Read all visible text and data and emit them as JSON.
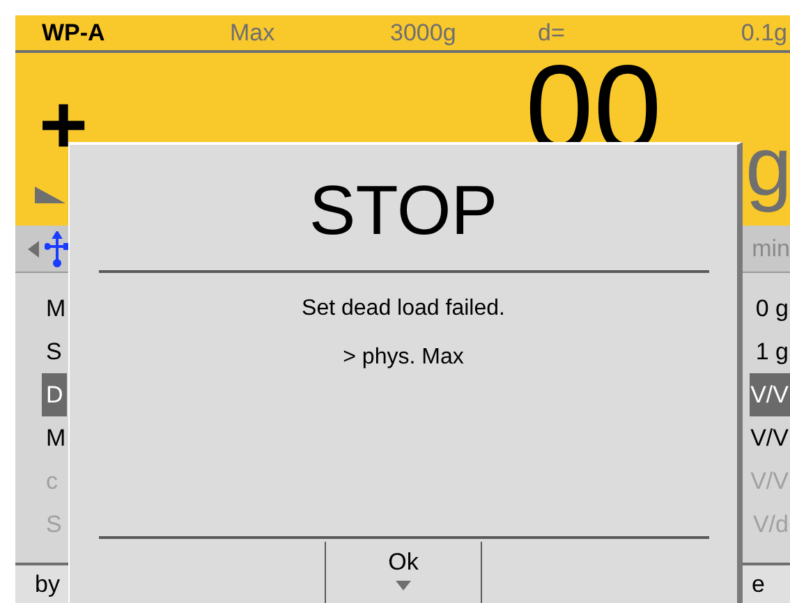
{
  "header": {
    "model": "WP-A",
    "max_label": "Max",
    "max_value": "3000g",
    "d_label": "d=",
    "d_value": "0.1g"
  },
  "display": {
    "sign": "+",
    "value": "00",
    "unit": "g"
  },
  "toolbar": {
    "right_text": "min"
  },
  "list": [
    {
      "label": "M",
      "value": "0 g",
      "selected": false,
      "disabled": false
    },
    {
      "label": "S",
      "value": "1 g",
      "selected": false,
      "disabled": false
    },
    {
      "label": "D",
      "value": "V/V",
      "selected": true,
      "disabled": false
    },
    {
      "label": "M",
      "value": "V/V",
      "selected": false,
      "disabled": false
    },
    {
      "label": "c",
      "value": "V/V",
      "selected": false,
      "disabled": true
    },
    {
      "label": "S",
      "value": "V/d",
      "selected": false,
      "disabled": true
    }
  ],
  "footer": {
    "left": "by",
    "right": "e"
  },
  "dialog": {
    "title": "STOP",
    "lines": [
      "Set dead load failed.",
      "> phys. Max"
    ],
    "buttons": [
      {
        "label": "Ok"
      }
    ]
  }
}
